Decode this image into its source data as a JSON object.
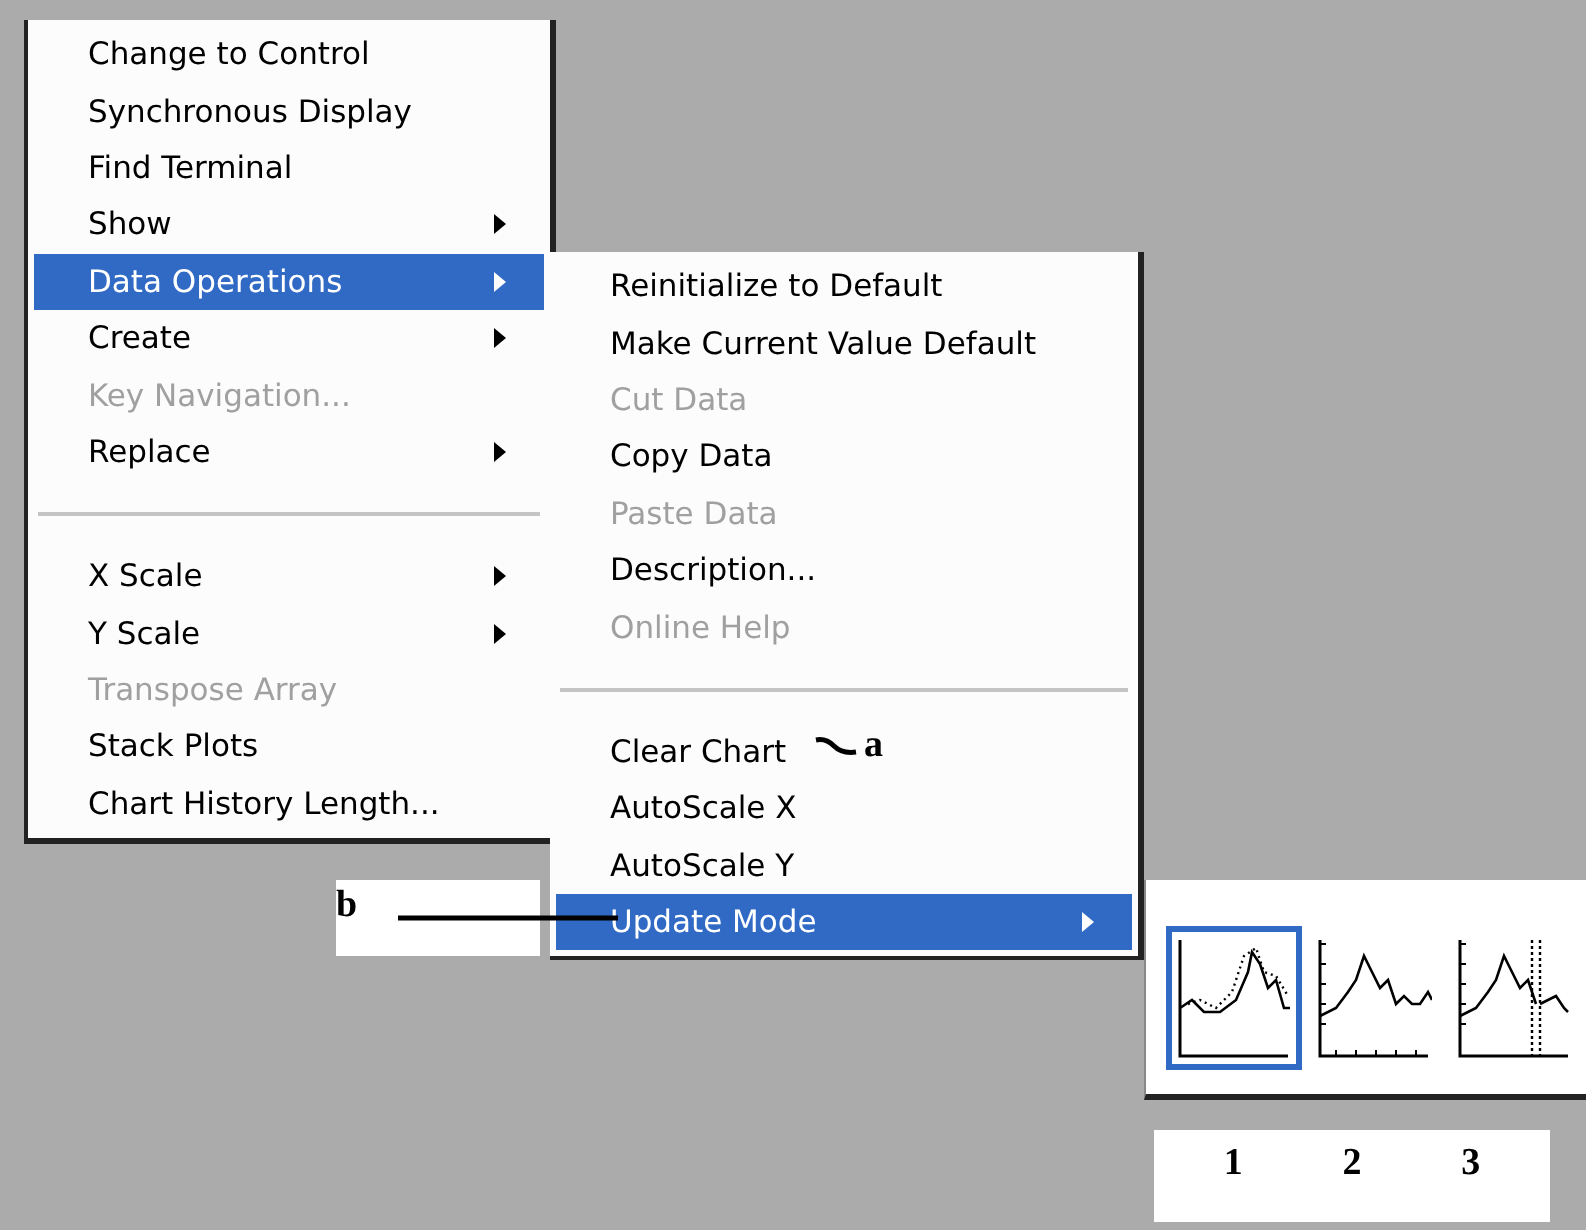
{
  "context_menu": {
    "items": [
      {
        "kind": "item",
        "label": "Change to Control",
        "disabled": false,
        "selected": false,
        "submenu": false
      },
      {
        "kind": "item",
        "label": "Synchronous Display",
        "disabled": false,
        "selected": false,
        "submenu": false
      },
      {
        "kind": "item",
        "label": "Find Terminal",
        "disabled": false,
        "selected": false,
        "submenu": false
      },
      {
        "kind": "item",
        "label": "Show",
        "disabled": false,
        "selected": false,
        "submenu": true
      },
      {
        "kind": "item",
        "label": "Data Operations",
        "disabled": false,
        "selected": true,
        "submenu": true
      },
      {
        "kind": "item",
        "label": "Create",
        "disabled": false,
        "selected": false,
        "submenu": true
      },
      {
        "kind": "item",
        "label": "Key Navigation...",
        "disabled": true,
        "selected": false,
        "submenu": false
      },
      {
        "kind": "item",
        "label": "Replace",
        "disabled": false,
        "selected": false,
        "submenu": true
      },
      {
        "kind": "separator"
      },
      {
        "kind": "item",
        "label": "X Scale",
        "disabled": false,
        "selected": false,
        "submenu": true
      },
      {
        "kind": "item",
        "label": "Y Scale",
        "disabled": false,
        "selected": false,
        "submenu": true
      },
      {
        "kind": "item",
        "label": "Transpose Array",
        "disabled": true,
        "selected": false,
        "submenu": false
      },
      {
        "kind": "item",
        "label": "Stack Plots",
        "disabled": false,
        "selected": false,
        "submenu": false
      },
      {
        "kind": "item",
        "label": "Chart History Length...",
        "disabled": false,
        "selected": false,
        "submenu": false
      }
    ]
  },
  "data_operations_menu": {
    "items": [
      {
        "kind": "item",
        "label": "Reinitialize to Default",
        "disabled": false,
        "selected": false,
        "submenu": false
      },
      {
        "kind": "item",
        "label": "Make Current Value Default",
        "disabled": false,
        "selected": false,
        "submenu": false
      },
      {
        "kind": "item",
        "label": "Cut Data",
        "disabled": true,
        "selected": false,
        "submenu": false
      },
      {
        "kind": "item",
        "label": "Copy Data",
        "disabled": false,
        "selected": false,
        "submenu": false
      },
      {
        "kind": "item",
        "label": "Paste Data",
        "disabled": true,
        "selected": false,
        "submenu": false
      },
      {
        "kind": "item",
        "label": "Description...",
        "disabled": false,
        "selected": false,
        "submenu": false
      },
      {
        "kind": "item",
        "label": "Online Help",
        "disabled": true,
        "selected": false,
        "submenu": false
      },
      {
        "kind": "separator"
      },
      {
        "kind": "item",
        "label": "Clear Chart",
        "disabled": false,
        "selected": false,
        "submenu": false
      },
      {
        "kind": "item",
        "label": "AutoScale X",
        "disabled": false,
        "selected": false,
        "submenu": false
      },
      {
        "kind": "item",
        "label": "AutoScale Y",
        "disabled": false,
        "selected": false,
        "submenu": false
      },
      {
        "kind": "item",
        "label": "Update Mode",
        "disabled": false,
        "selected": true,
        "submenu": true
      }
    ]
  },
  "update_mode_palette": {
    "options": [
      {
        "kind": "strip",
        "selected": true
      },
      {
        "kind": "scope",
        "selected": false
      },
      {
        "kind": "sweep",
        "selected": false
      }
    ]
  },
  "option_numbers": [
    "1",
    "2",
    "3"
  ],
  "callouts": [
    {
      "label": "a"
    },
    {
      "label": "b"
    }
  ]
}
